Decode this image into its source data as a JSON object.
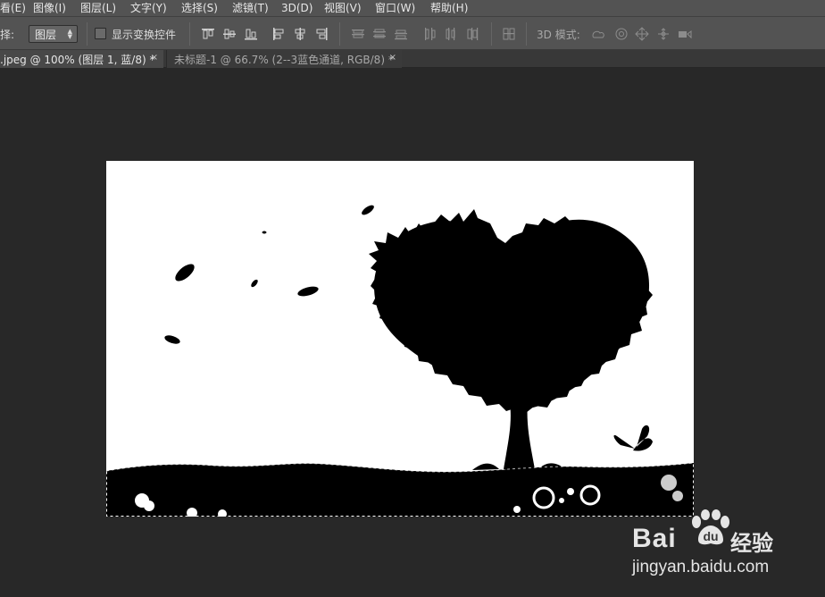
{
  "menu": {
    "items": [
      "看(E)",
      "图像(I)",
      "图层(L)",
      "文字(Y)",
      "选择(S)",
      "滤镜(T)",
      "3D(D)",
      "视图(V)",
      "窗口(W)",
      "帮助(H)"
    ]
  },
  "options": {
    "select_label": "择:",
    "select_value": "图层",
    "show_transform_label": "显示变换控件",
    "mode_3d_label": "3D 模式:"
  },
  "tabs": [
    {
      "label": ".jpeg @ 100% (图层 1, 蓝/8) *",
      "close": "×"
    },
    {
      "label": "未标题-1 @ 66.7% (2--3蓝色通道, RGB/8) *",
      "close": "×"
    }
  ],
  "watermark": {
    "brand_left": "Bai",
    "brand_right": "经验",
    "url": "jingyan.baidu.com"
  },
  "colors": {
    "ui_bg": "#535353",
    "workspace": "#282828",
    "canvas_bg": "#ffffff",
    "silhouette": "#000000"
  }
}
